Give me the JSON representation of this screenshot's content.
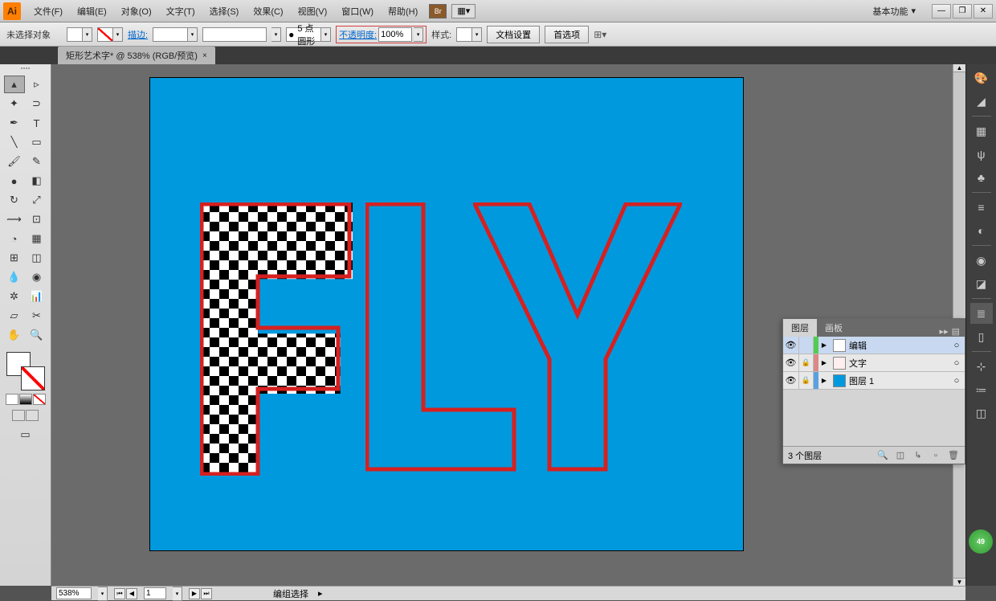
{
  "menu": {
    "file": "文件(F)",
    "edit": "编辑(E)",
    "object": "对象(O)",
    "type": "文字(T)",
    "select": "选择(S)",
    "effect": "效果(C)",
    "view": "视图(V)",
    "window": "窗口(W)",
    "help": "帮助(H)"
  },
  "workspace": "基本功能",
  "control": {
    "no_selection": "未选择对象",
    "stroke_label": "描边:",
    "stroke_weight": "",
    "dash": "5 点圆形",
    "opacity_label": "不透明度:",
    "opacity_value": "100%",
    "style_label": "样式:",
    "doc_setup": "文档设置",
    "prefs": "首选项"
  },
  "tab": {
    "title": "矩形艺术字* @ 538% (RGB/预览)"
  },
  "layers_panel": {
    "tab_layers": "图层",
    "tab_artboards": "画板",
    "rows": [
      {
        "name": "编辑",
        "color": "#52cc52"
      },
      {
        "name": "文字",
        "color": "#d88"
      },
      {
        "name": "图层 1",
        "color": "#5aa0e0"
      }
    ],
    "count": "3 个图层"
  },
  "status": {
    "zoom": "538%",
    "page": "1",
    "mode": "编组选择"
  },
  "badge": "49"
}
